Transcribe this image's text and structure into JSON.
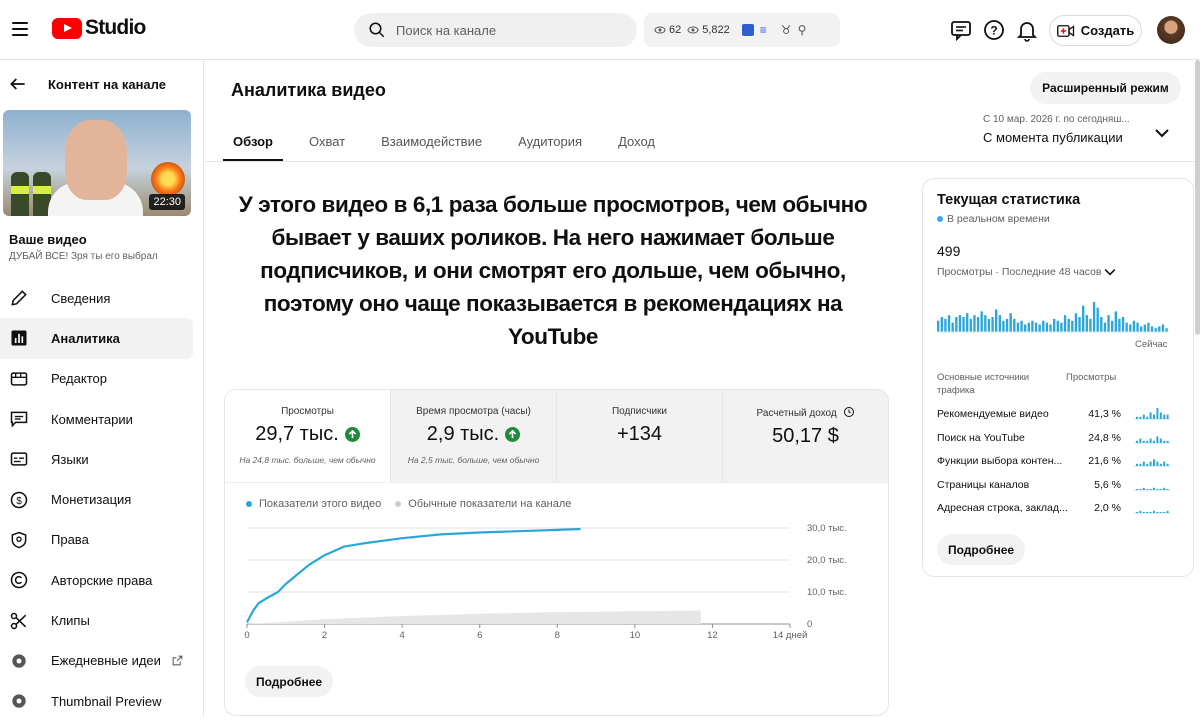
{
  "app": {
    "name": "Studio"
  },
  "header": {
    "search_placeholder": "Поиск на канале",
    "stat1": "62",
    "stat2": "5,822",
    "create_label": "Создать"
  },
  "sidebar": {
    "back_label": "Контент на канале",
    "video_duration": "22:30",
    "your_video_label": "Ваше видео",
    "video_title": "ДУБАЙ ВСЕ! Зря ты его выбрал",
    "items": [
      {
        "label": "Сведения",
        "icon": "pencil-icon"
      },
      {
        "label": "Аналитика",
        "icon": "analytics-icon"
      },
      {
        "label": "Редактор",
        "icon": "editor-icon"
      },
      {
        "label": "Комментарии",
        "icon": "comment-icon"
      },
      {
        "label": "Языки",
        "icon": "subtitles-icon"
      },
      {
        "label": "Монетизация",
        "icon": "dollar-icon"
      },
      {
        "label": "Права",
        "icon": "shield-icon"
      },
      {
        "label": "Авторские права",
        "icon": "copyright-icon"
      },
      {
        "label": "Клипы",
        "icon": "scissors-icon"
      },
      {
        "label": "Ежедневные идеи",
        "icon": "ideas-icon"
      },
      {
        "label": "Thumbnail Preview",
        "icon": "thumbnail-icon"
      }
    ]
  },
  "main": {
    "title": "Аналитика видео",
    "advanced_button": "Расширенный режим",
    "tabs": [
      "Обзор",
      "Охват",
      "Взаимодействие",
      "Аудитория",
      "Доход"
    ],
    "active_tab": 0,
    "date_range_small": "С 10 мар. 2026 г. по сегодняш...",
    "date_range": "С момента публикации",
    "headline": "У этого видео в 6,1 раза больше просмотров, чем обычно бывает у ваших роликов. На него нажимает больше подписчиков, и они смотрят его дольше, чем обычно, поэтому оно чаще показывается в рекомендациях на YouTube",
    "metrics": [
      {
        "label": "Просмотры",
        "value": "29,7 тыс.",
        "trend": "up",
        "note": "На 24,8 тыс. больше, чем обычно"
      },
      {
        "label": "Время просмотра (часы)",
        "value": "2,9 тыс.",
        "trend": "up",
        "note": "На 2,5 тыс. больше, чем обычно"
      },
      {
        "label": "Подписчики",
        "value": "+134",
        "trend": "",
        "note": ""
      },
      {
        "label": "Расчетный доход",
        "value": "50,17 $",
        "trend": "",
        "note": ""
      }
    ],
    "legend": {
      "this_video": "Показатели этого видео",
      "typical": "Обычные показатели на канале"
    },
    "more_button": "Подробнее"
  },
  "chart_data": {
    "type": "line",
    "x_ticks": [
      "0",
      "2",
      "4",
      "6",
      "8",
      "10",
      "12",
      "14 дней"
    ],
    "y_ticks": [
      "0",
      "10,0 тыс.",
      "20,0 тыс.",
      "30,0 тыс."
    ],
    "ylim": [
      0,
      30000
    ],
    "xlim": [
      0,
      14
    ],
    "series": [
      {
        "name": "Показатели этого видео",
        "color": "#2aa7d8",
        "x": [
          0,
          0.15,
          0.3,
          0.5,
          0.8,
          1.0,
          1.3,
          1.6,
          2.0,
          2.5,
          3.0,
          3.5,
          4.0,
          5.0,
          6.0,
          7.0,
          8.0,
          8.6
        ],
        "y": [
          500,
          4000,
          6500,
          8000,
          10000,
          12500,
          15500,
          18500,
          21500,
          24200,
          25200,
          26000,
          26800,
          28000,
          28600,
          29000,
          29400,
          29700
        ]
      },
      {
        "name": "Обычные показатели на канале",
        "color": "#e6e6e6",
        "x": [
          0,
          2,
          4,
          6,
          8,
          10,
          11.7
        ],
        "y": [
          0,
          1500,
          2500,
          3200,
          3700,
          4000,
          4200
        ],
        "band": true
      }
    ]
  },
  "realtime": {
    "title": "Текущая статистика",
    "live_label": "В реальном времени",
    "value": "499",
    "subtitle": "Просмотры · Последние 48 часов",
    "now_label": "Сейчас",
    "bars": [
      6,
      8,
      7,
      9,
      5,
      8,
      9,
      8,
      10,
      7,
      9,
      8,
      11,
      9,
      7,
      8,
      12,
      9,
      6,
      7,
      10,
      7,
      5,
      6,
      4,
      5,
      6,
      5,
      4,
      6,
      5,
      4,
      7,
      6,
      5,
      9,
      7,
      6,
      10,
      8,
      14,
      9,
      7,
      16,
      13,
      8,
      5,
      9,
      6,
      11,
      7,
      8,
      5,
      4,
      6,
      5,
      3,
      4,
      5,
      3,
      2,
      3,
      4,
      2
    ],
    "sources_header": "Основные источники трафика",
    "sources_metric": "Просмотры",
    "sources": [
      {
        "name": "Рекомендуемые видео",
        "pct": "41,3 %",
        "spark": [
          1,
          1,
          2,
          1,
          3,
          2,
          5,
          3,
          2,
          2
        ]
      },
      {
        "name": "Поиск на YouTube",
        "pct": "24,8 %",
        "spark": [
          1,
          2,
          1,
          1,
          2,
          1,
          3,
          2,
          1,
          1
        ]
      },
      {
        "name": "Функции выбора контен...",
        "pct": "21,6 %",
        "spark": [
          1,
          1,
          2,
          1,
          2,
          3,
          2,
          1,
          2,
          1
        ]
      },
      {
        "name": "Страницы каналов",
        "pct": "5,6 %",
        "spark": [
          0,
          0,
          1,
          0,
          0,
          1,
          0,
          0,
          1,
          0
        ]
      },
      {
        "name": "Адресная строка, заклад...",
        "pct": "2,0 %",
        "spark": [
          0,
          1,
          0,
          0,
          0,
          1,
          0,
          0,
          0,
          1
        ]
      }
    ],
    "more_button": "Подробнее",
    "accent": "#2aa7d8"
  }
}
